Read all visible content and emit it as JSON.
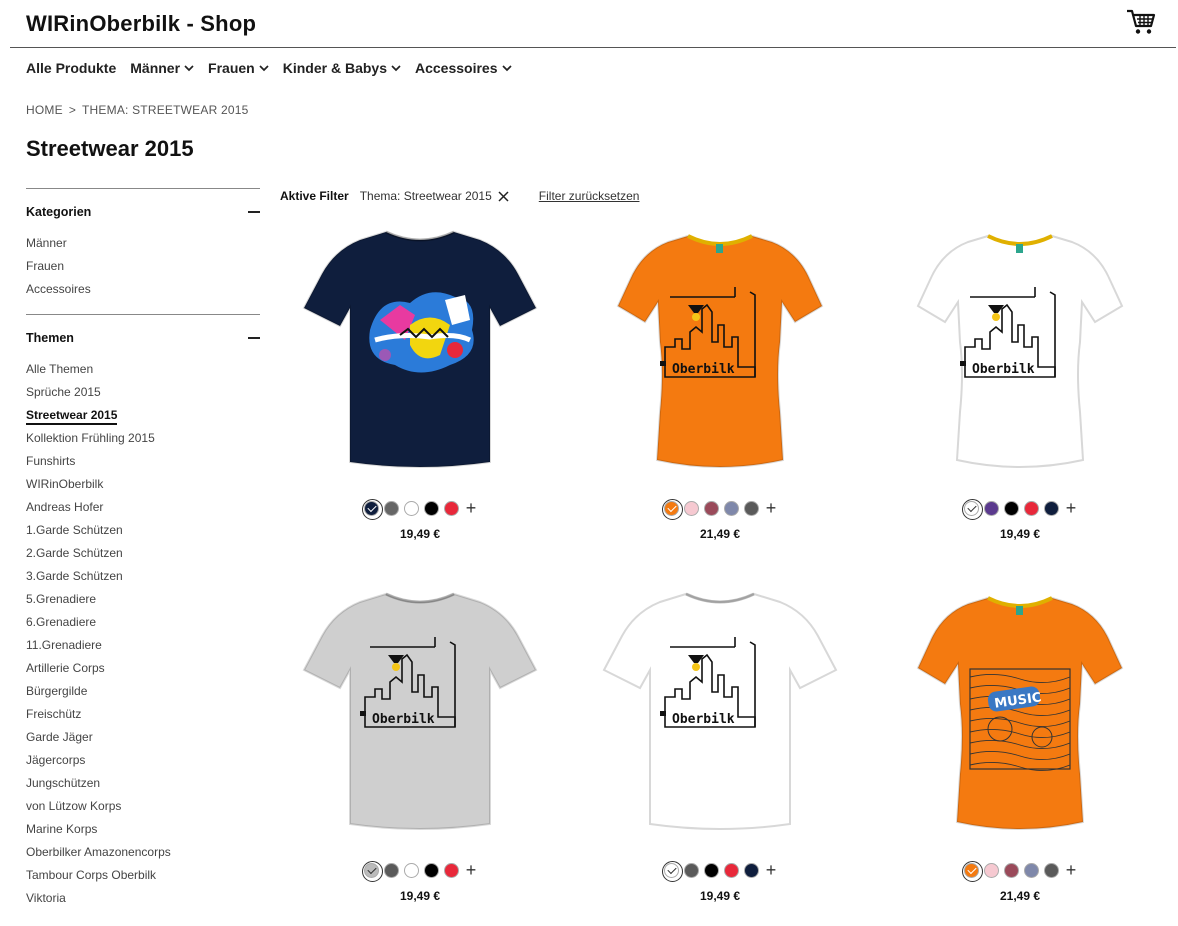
{
  "header": {
    "title": "WIRinOberbilk - Shop",
    "cart_icon": "shopping-cart-icon"
  },
  "nav": [
    {
      "label": "Alle Produkte",
      "dropdown": false
    },
    {
      "label": "Männer",
      "dropdown": true
    },
    {
      "label": "Frauen",
      "dropdown": true
    },
    {
      "label": "Kinder & Babys",
      "dropdown": true
    },
    {
      "label": "Accessoires",
      "dropdown": true
    }
  ],
  "breadcrumb": {
    "home": "HOME",
    "separator": ">",
    "current": "THEMA: STREETWEAR 2015"
  },
  "page_title": "Streetwear 2015",
  "sidebar": {
    "categories": {
      "title": "Kategorien",
      "items": [
        "Männer",
        "Frauen",
        "Accessoires"
      ]
    },
    "themes": {
      "title": "Themen",
      "active": "Streetwear 2015",
      "items": [
        "Alle Themen",
        "Sprüche 2015",
        "Streetwear 2015",
        "Kollektion Frühling 2015",
        "Funshirts",
        "WIRinOberbilk",
        "Andreas Hofer",
        "1.Garde Schützen",
        "2.Garde Schützen",
        "3.Garde Schützen",
        "5.Grenadiere",
        "6.Grenadiere",
        "11.Grenadiere",
        "Artillerie Corps",
        "Bürgergilde",
        "Freischütz",
        "Garde Jäger",
        "Jägercorps",
        "Jungschützen",
        "von Lützow Korps",
        "Marine Korps",
        "Oberbilker Amazonencorps",
        "Tambour Corps Oberbilk",
        "Viktoria"
      ]
    }
  },
  "filters": {
    "label": "Aktive Filter",
    "active_chip": "Thema: Streetwear 2015",
    "reset": "Filter zurücksetzen"
  },
  "products": [
    {
      "shirt_color": "#0f1e3d",
      "fit": "men",
      "design": "graffiti",
      "price": "19,49 €",
      "swatches": [
        "#0f1e3d",
        "#666666",
        "#ffffff",
        "#000000",
        "#e8283a"
      ],
      "selected": 0
    },
    {
      "shirt_color": "#f47a10",
      "fit": "women",
      "design": "skyline",
      "price": "21,49 €",
      "swatches": [
        "#f47a10",
        "#f6c9d1",
        "#9a4a5a",
        "#7f88aa",
        "#5a5a5a"
      ],
      "selected": 0
    },
    {
      "shirt_color": "#ffffff",
      "fit": "women",
      "design": "skyline",
      "price": "19,49 €",
      "swatches": [
        "#ffffff",
        "#5b3a8e",
        "#000000",
        "#e8283a",
        "#0f1e3d"
      ],
      "selected": 0
    },
    {
      "shirt_color": "#cfcfcf",
      "fit": "men",
      "design": "skyline",
      "price": "19,49 €",
      "swatches": [
        "#bbbbbb",
        "#5a5a5a",
        "#ffffff",
        "#000000",
        "#e8283a"
      ],
      "selected": 0
    },
    {
      "shirt_color": "#ffffff",
      "fit": "men",
      "design": "skyline",
      "price": "19,49 €",
      "swatches": [
        "#ffffff",
        "#5a5a5a",
        "#000000",
        "#e8283a",
        "#0f1e3d"
      ],
      "selected": 0
    },
    {
      "shirt_color": "#f47a10",
      "fit": "women",
      "design": "music",
      "price": "21,49 €",
      "swatches": [
        "#f47a10",
        "#f6c9d1",
        "#9a4a5a",
        "#7f88aa",
        "#5a5a5a"
      ],
      "selected": 0
    }
  ],
  "icons": {
    "chevron": "chevron-down-icon",
    "close": "close-icon",
    "plus": "plus-icon"
  }
}
